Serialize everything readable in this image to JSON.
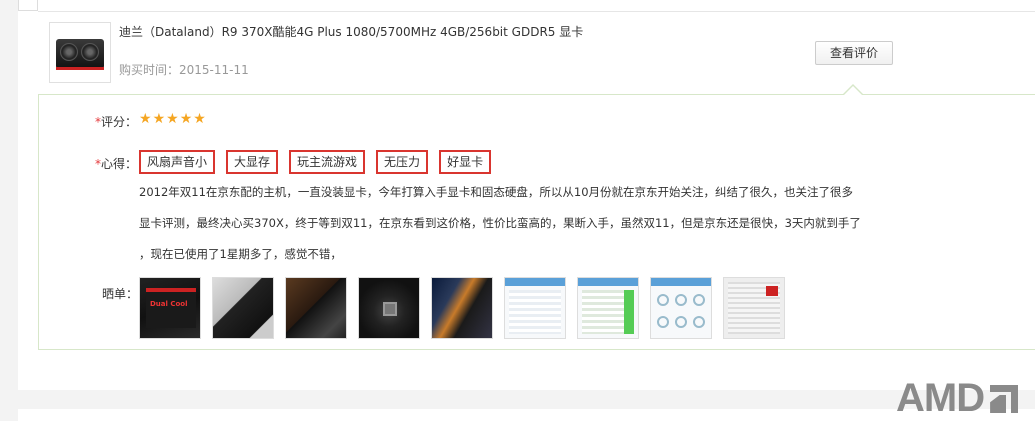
{
  "product": {
    "title": "迪兰（Dataland）R9 370X酷能4G Plus 1080/5700MHz 4GB/256bit GDDR5 显卡",
    "buy_time_label": "购买时间：",
    "buy_time": "2015-11-11",
    "review_button": "查看评价"
  },
  "review": {
    "rating_label": "评分：",
    "rating_stars": 5,
    "comment_label": "心得：",
    "required_mark": "*",
    "tags": [
      "风扇声音小",
      "大显存",
      "玩主流游戏",
      "无压力",
      "好显卡"
    ],
    "content_lines": [
      "2012年双11在京东配的主机，一直没装显卡，今年打算入手显卡和固态硬盘，所以从10月份就在京东开始关注，纠结了很久，也关注了很多",
      "显卡评测，最终决心买370X，终于等到双11，在京东看到这价格，性价比蛮高的，果断入手，虽然双11，但是京东还是很快，3天内就到手了",
      "，现在已使用了1星期多了，感觉不错，"
    ],
    "photos_label": "晒单：",
    "photos": [
      {
        "name": "graphics-card-box-photo",
        "text": "Dual Cool"
      },
      {
        "name": "graphics-card-photo"
      },
      {
        "name": "card-installed-photo"
      },
      {
        "name": "motherboard-photo"
      },
      {
        "name": "pc-interior-photo"
      },
      {
        "name": "gpu-info-screenshot"
      },
      {
        "name": "benchmark-screenshot"
      },
      {
        "name": "monitor-screenshot"
      },
      {
        "name": "gpu-z-screenshot"
      }
    ]
  },
  "watermark": {
    "brand": "AMD"
  },
  "colors": {
    "required": "#e4393c",
    "tag_border": "#d9352f",
    "star": "#f5a623",
    "panel_border": "#d7e7c9"
  }
}
